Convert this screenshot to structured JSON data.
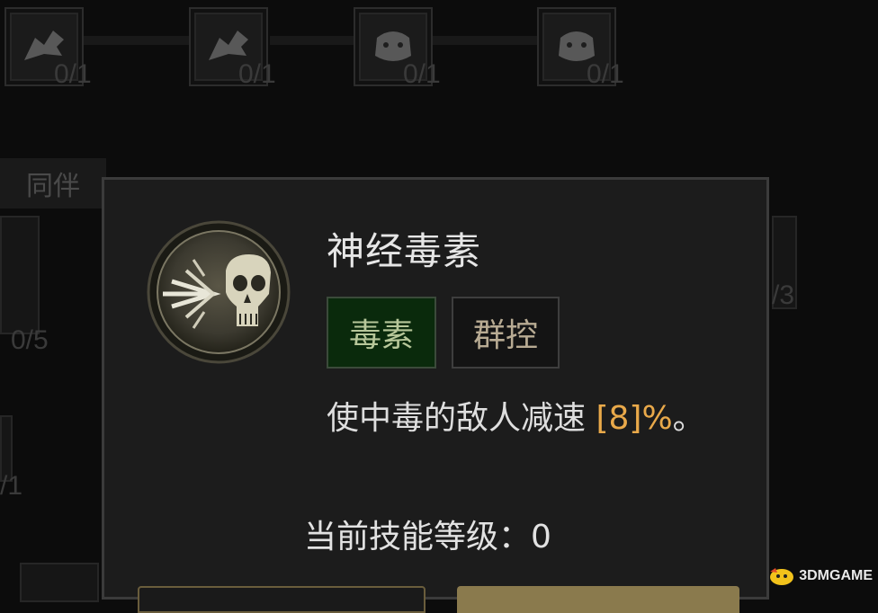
{
  "background": {
    "top_nodes": [
      {
        "icon": "wolf-icon",
        "count": "0/1"
      },
      {
        "icon": "wolf-icon",
        "count": "0/1"
      },
      {
        "icon": "bear-icon",
        "count": "0/1"
      },
      {
        "icon": "bear-icon",
        "count": "0/1"
      }
    ],
    "section_label": "同伴",
    "side_counts": {
      "left_mid": "0/5",
      "left_low": "/1",
      "right_mid": "/3"
    }
  },
  "tooltip": {
    "icon": "poison-skull-icon",
    "title": "神经毒素",
    "tags": [
      "毒素",
      "群控"
    ],
    "description_prefix": "使中毒的敌人减速 ",
    "description_value": "[8]%",
    "description_suffix": "。",
    "level_text": "当前技能等级：0"
  },
  "watermark": {
    "text": "3DMGAME"
  },
  "colors": {
    "tooltip_bg": "#1c1c1c",
    "highlight": "#e9a94a",
    "poison_tag_bg": "#0a2a0c"
  }
}
